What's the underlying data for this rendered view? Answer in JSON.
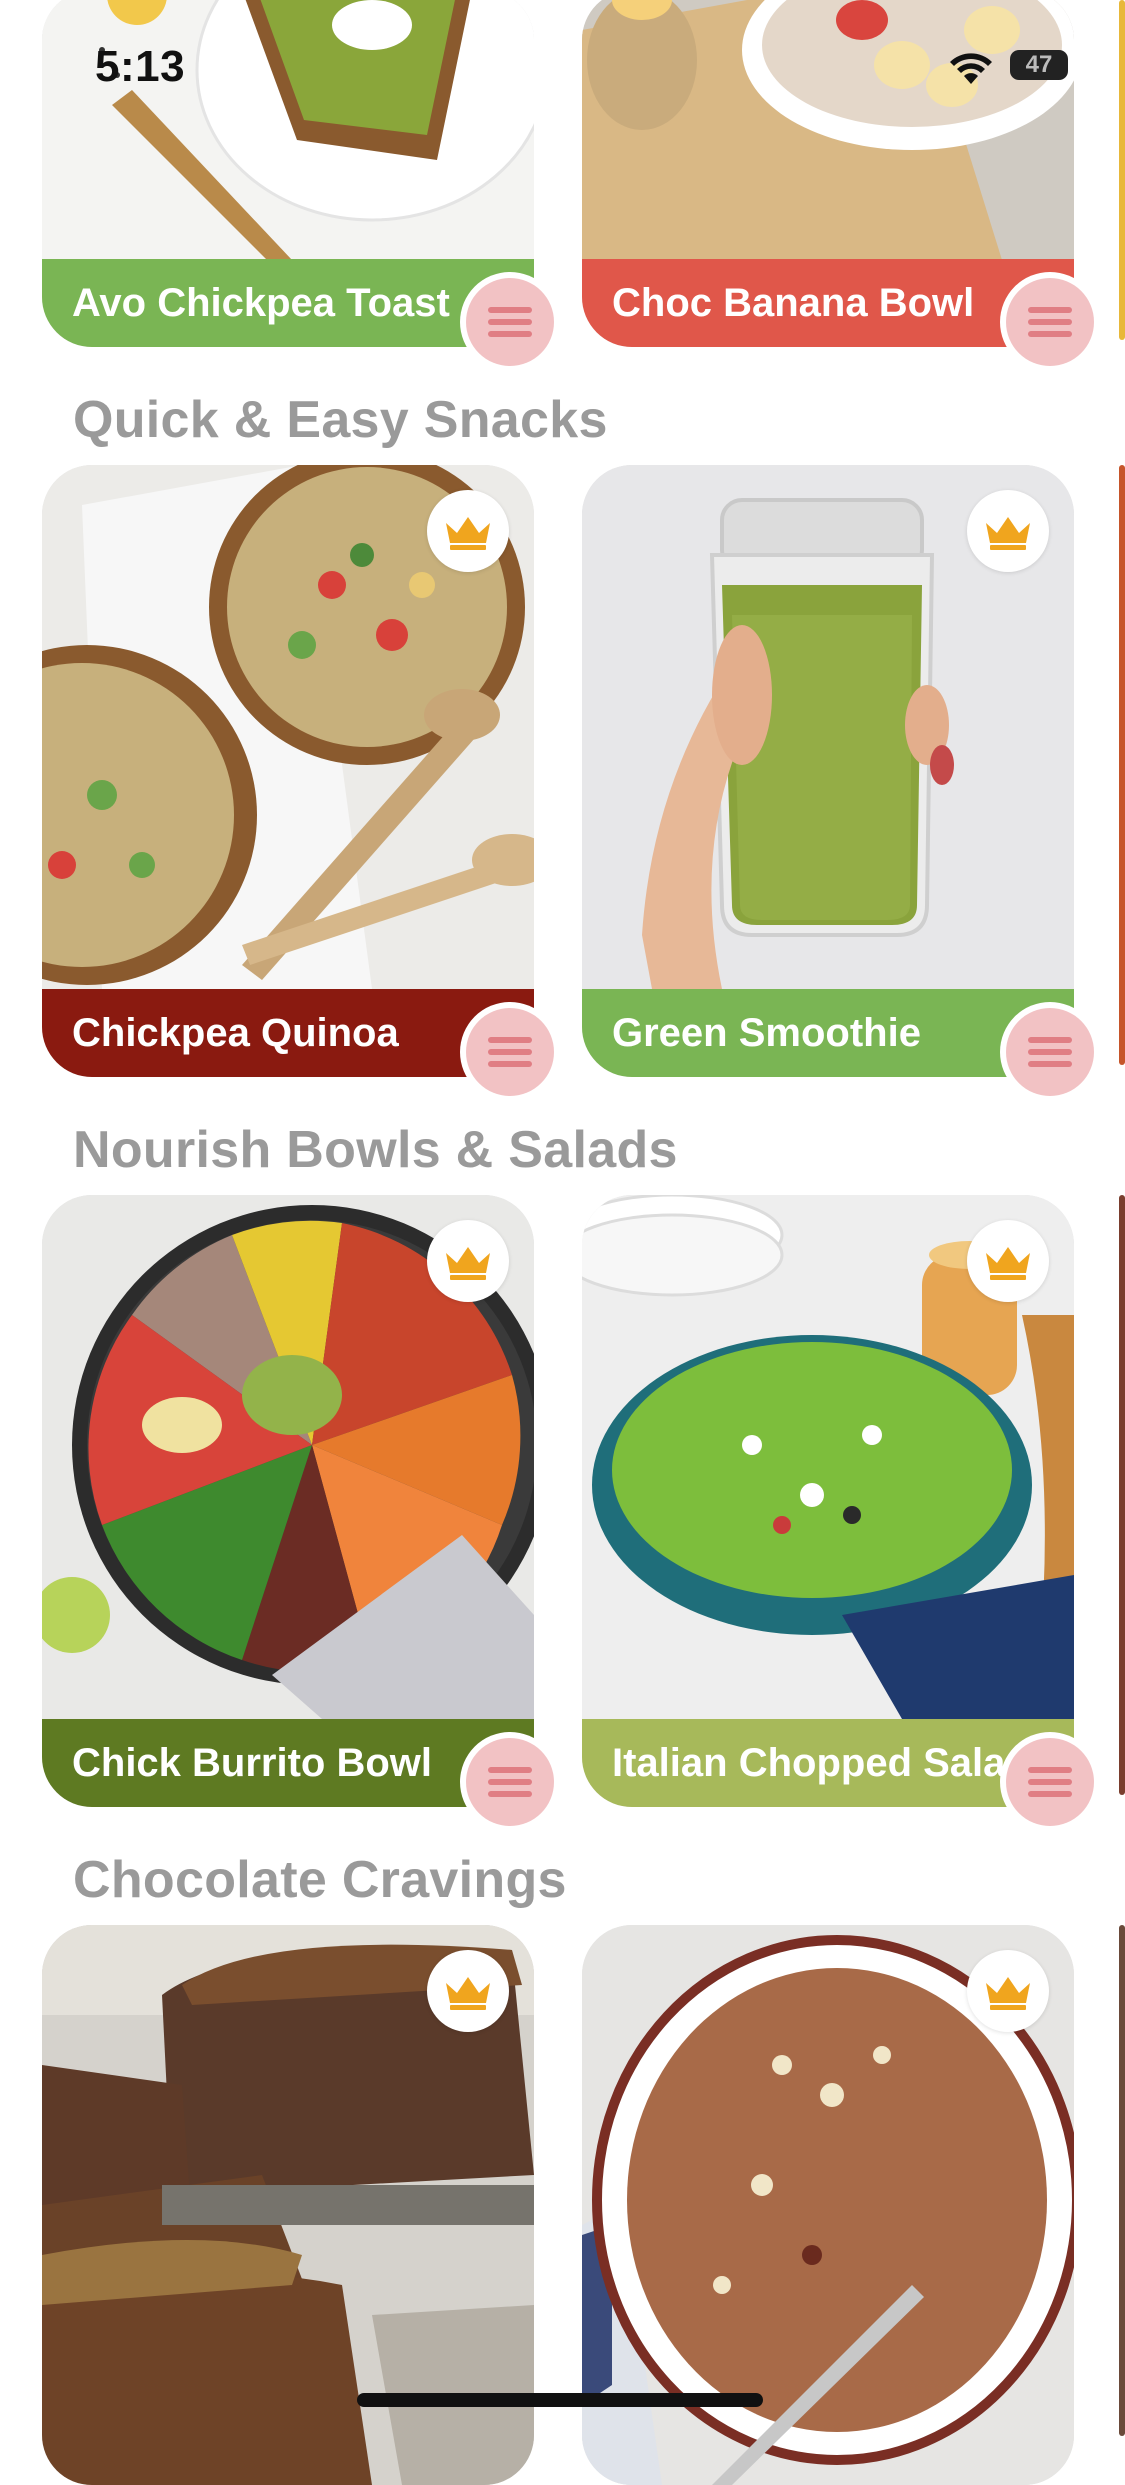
{
  "status_bar": {
    "time": "5:13",
    "battery": "47"
  },
  "featured_row": [
    {
      "name": "Avo Chickpea Toast",
      "bar_color": "#7ab554"
    },
    {
      "name": "Choc Banana Bowl",
      "bar_color": "#e0574a"
    }
  ],
  "sections": [
    {
      "title": "Quick & Easy Snacks",
      "cards": [
        {
          "name": "Chickpea Quinoa",
          "bar_color": "#8a1a10",
          "premium": true
        },
        {
          "name": "Green Smoothie",
          "bar_color": "#7ab554",
          "premium": true
        }
      ]
    },
    {
      "title": "Nourish Bowls & Salads",
      "cards": [
        {
          "name": "Chick Burrito Bowl",
          "bar_color": "#5e7a22",
          "premium": true
        },
        {
          "name": "Italian Chopped Salad",
          "bar_color": "#a7b95a",
          "premium": true
        }
      ]
    },
    {
      "title": "Chocolate Cravings",
      "cards": [
        {
          "name": "",
          "premium": true
        },
        {
          "name": "",
          "premium": true
        }
      ]
    }
  ],
  "icons": {
    "crown": "crown-icon",
    "menu": "menu-lines-icon",
    "wifi": "wifi-icon",
    "battery": "battery-icon"
  },
  "colors": {
    "section_title": "#9a9a9a",
    "menu_button": "#f2c2c4",
    "menu_lines": "#e07e84",
    "crown": "#f0a51e"
  }
}
